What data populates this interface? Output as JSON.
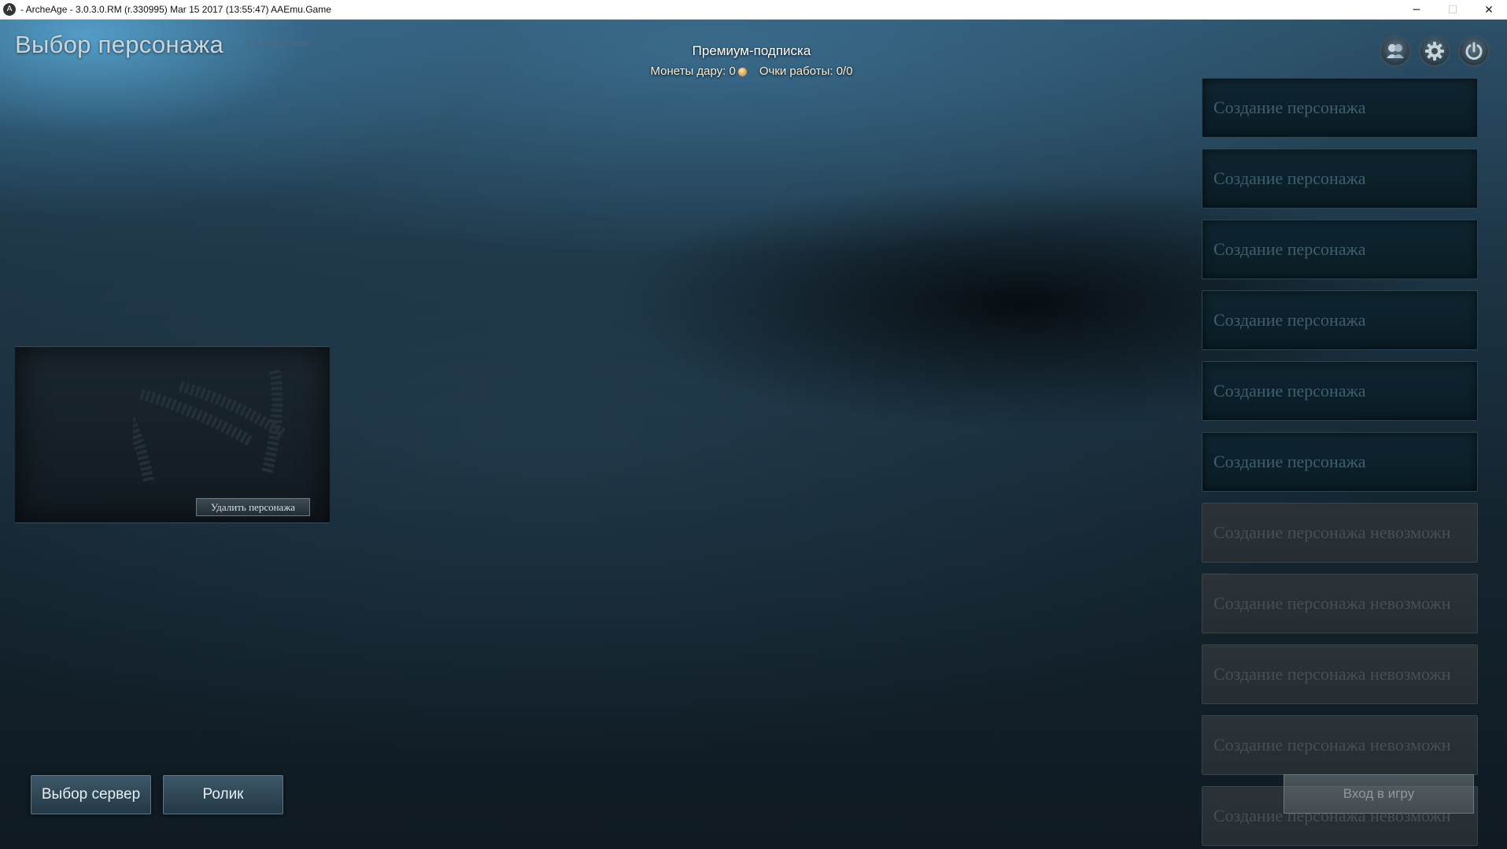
{
  "window": {
    "title": "- ArcheAge - 3.0.3.0.RM (r.330995) Mar 15 2017 (13:55:47) AAEmu.Game",
    "app_icon": "archeage-logo-icon",
    "minimize": "─",
    "maximize": "☐",
    "close": "✕"
  },
  "header": {
    "title": "Выбор персонажа",
    "brand": "AAEmu.Game"
  },
  "premium": {
    "title": "Премиум-подписка",
    "coins_label": "Монеты дару: 0",
    "work_points_label": "Очки работы: 0/0"
  },
  "top_icons": [
    "friends-icon",
    "gear-icon",
    "power-icon"
  ],
  "preview": {
    "delete_label": "Удалить персонажа"
  },
  "slots": [
    {
      "label": "Создание персонажа",
      "state": "active"
    },
    {
      "label": "Создание персонажа",
      "state": "active"
    },
    {
      "label": "Создание персонажа",
      "state": "active"
    },
    {
      "label": "Создание персонажа",
      "state": "active"
    },
    {
      "label": "Создание персонажа",
      "state": "active"
    },
    {
      "label": "Создание персонажа",
      "state": "active"
    },
    {
      "label": "Создание персонажа невозможн",
      "state": "locked"
    },
    {
      "label": "Создание персонажа невозможн",
      "state": "locked"
    },
    {
      "label": "Создание персонажа невозможн",
      "state": "locked"
    },
    {
      "label": "Создание персонажа невозможн",
      "state": "locked"
    },
    {
      "label": "Создание персонажа невозможн",
      "state": "locked"
    }
  ],
  "bottom": {
    "server_select": "Выбор сервер",
    "video": "Ролик",
    "enter_game": "Вход в игру"
  }
}
